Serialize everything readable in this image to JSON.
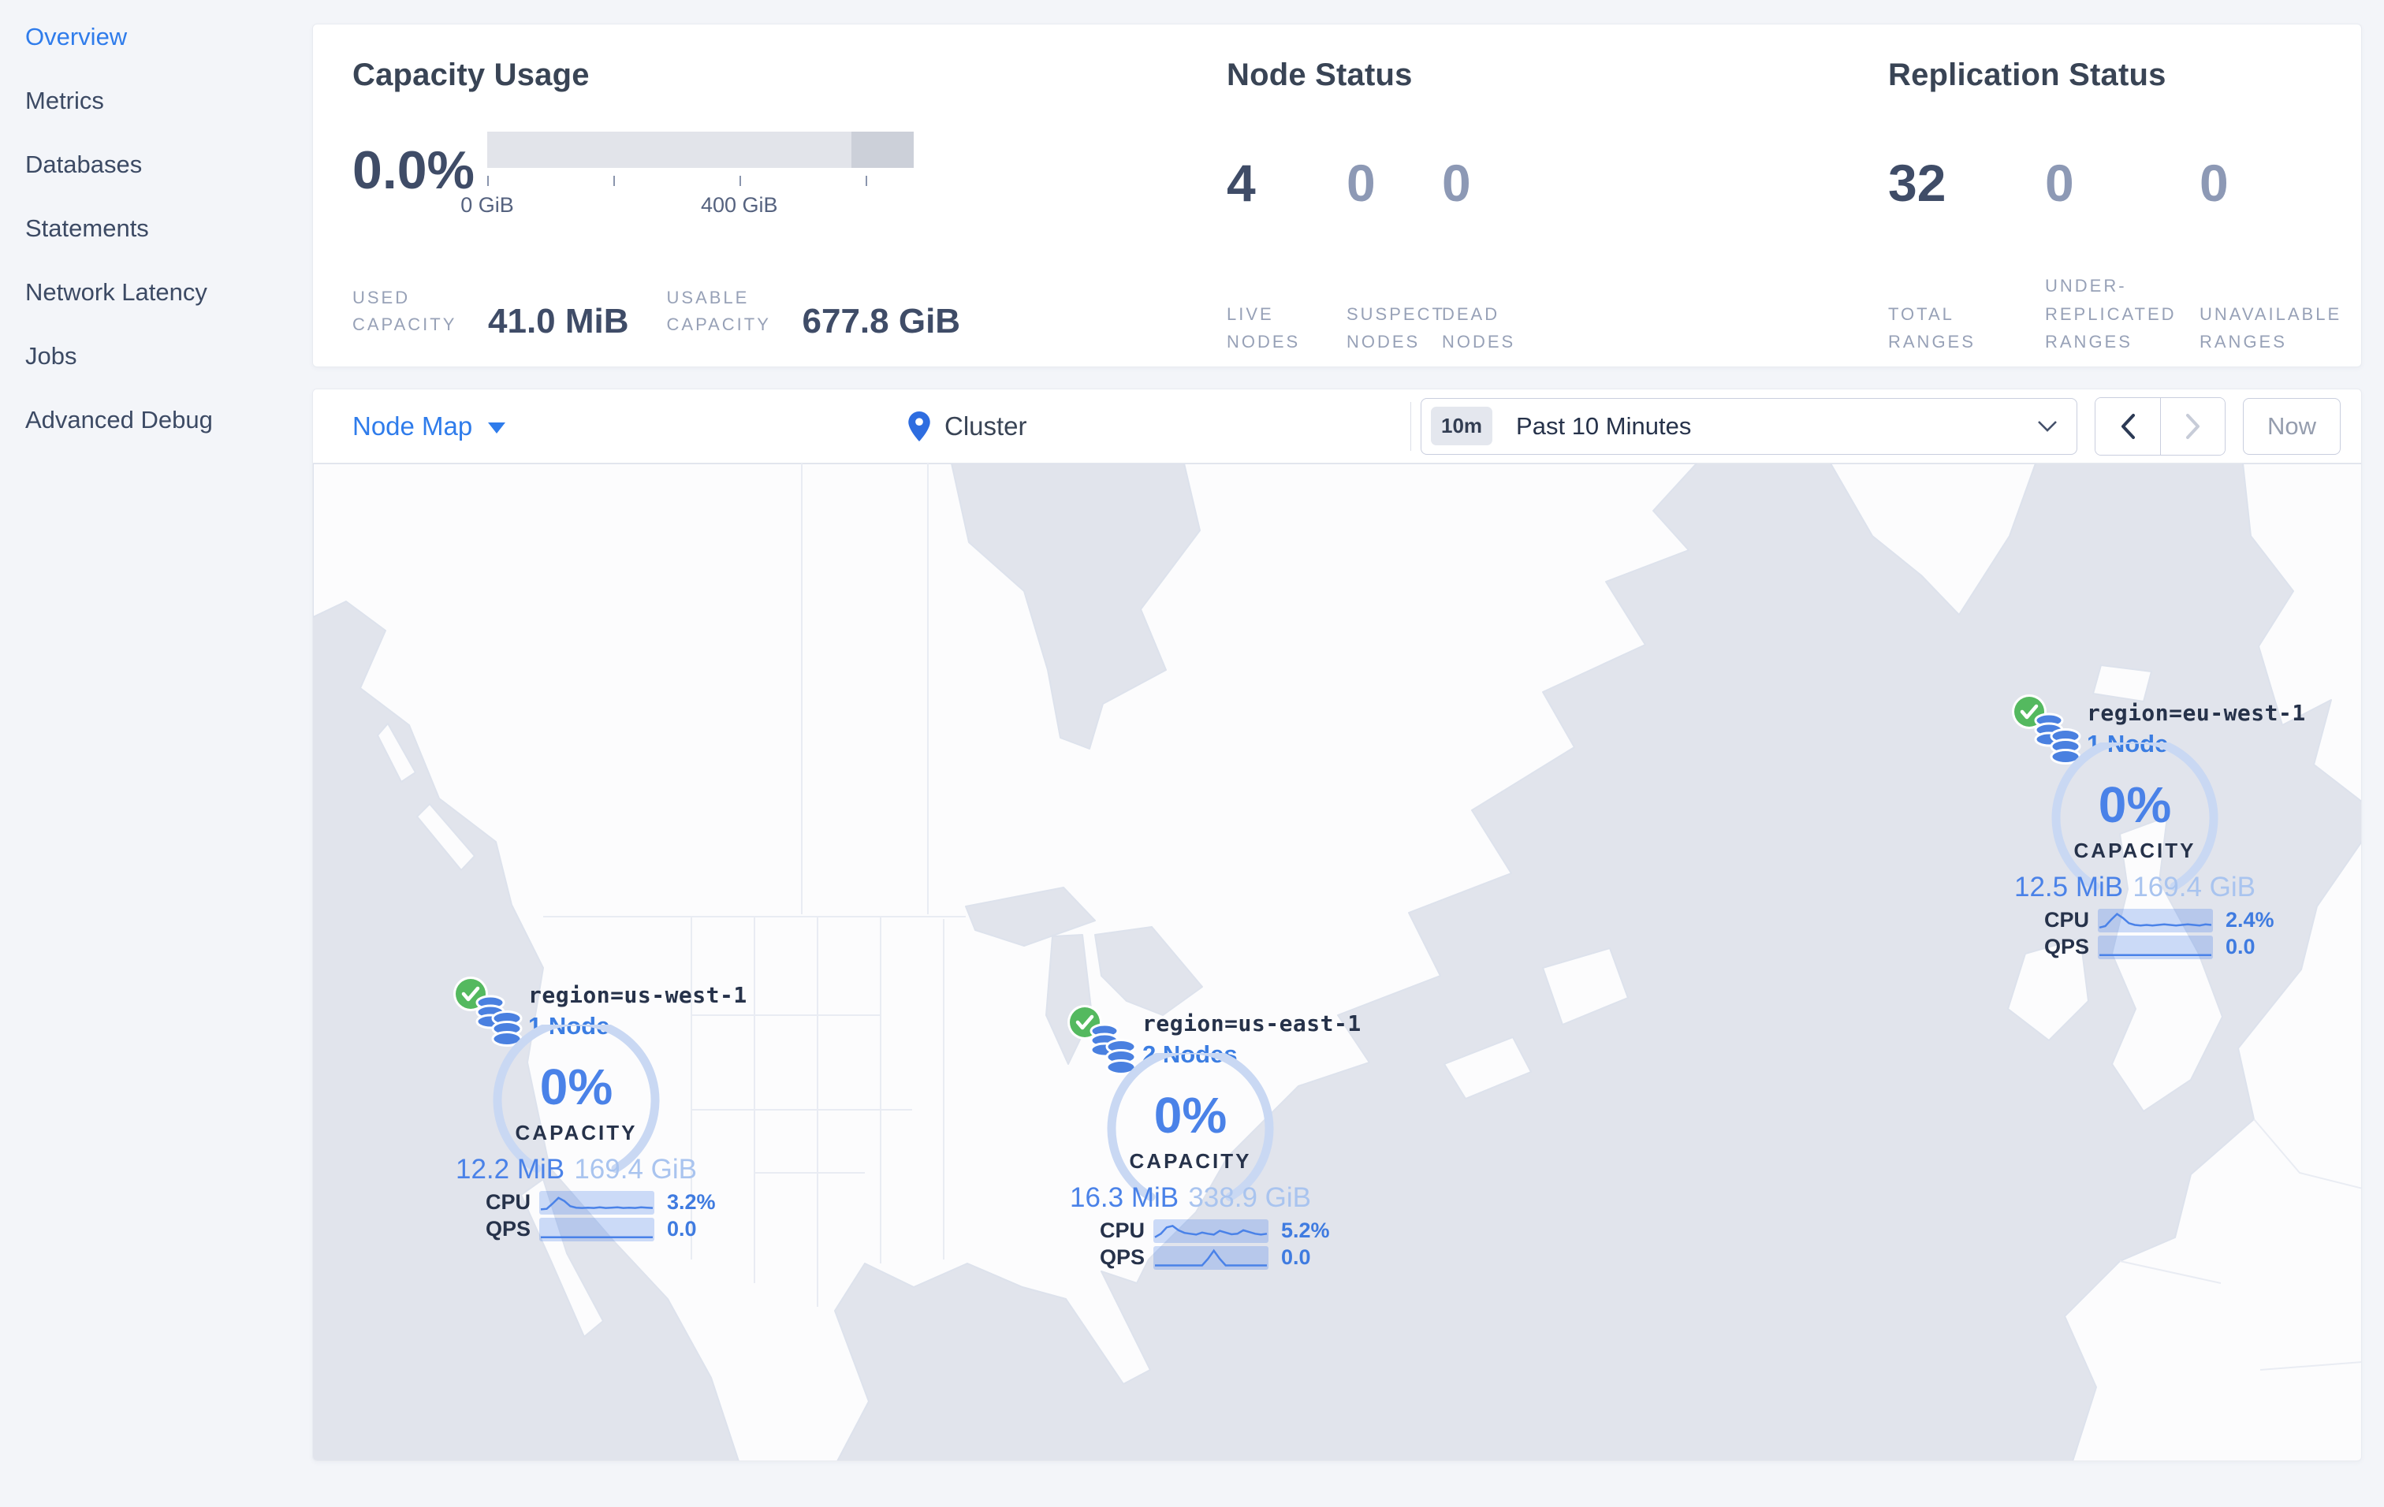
{
  "sidebar": {
    "items": [
      {
        "label": "Overview",
        "active": true
      },
      {
        "label": "Metrics",
        "active": false
      },
      {
        "label": "Databases",
        "active": false
      },
      {
        "label": "Statements",
        "active": false
      },
      {
        "label": "Network Latency",
        "active": false
      },
      {
        "label": "Jobs",
        "active": false
      },
      {
        "label": "Advanced Debug",
        "active": false
      }
    ]
  },
  "summary": {
    "capacity": {
      "title": "Capacity Usage",
      "percent": "0.0%",
      "tick_label_zero": "0 GiB",
      "tick_label_400": "400 GiB",
      "used_label": "USED CAPACITY",
      "used_value": "41.0 MiB",
      "usable_label": "USABLE CAPACITY",
      "usable_value": "677.8 GiB"
    },
    "node_status": {
      "title": "Node Status",
      "stats": [
        {
          "value": "4",
          "label": "LIVE NODES",
          "muted": false
        },
        {
          "value": "0",
          "label": "SUSPECT NODES",
          "muted": true
        },
        {
          "value": "0",
          "label": "DEAD NODES",
          "muted": true
        }
      ]
    },
    "replication": {
      "title": "Replication Status",
      "stats": [
        {
          "value": "32",
          "label": "TOTAL RANGES",
          "muted": false
        },
        {
          "value": "0",
          "label": "UNDER-REPLICATED RANGES",
          "muted": true
        },
        {
          "value": "0",
          "label": "UNAVAILABLE RANGES",
          "muted": true
        }
      ]
    }
  },
  "toolbar": {
    "view_label": "Node Map",
    "breadcrumb": "Cluster",
    "time_badge": "10m",
    "time_range": "Past 10 Minutes",
    "now_label": "Now"
  },
  "markers": [
    {
      "region": "region=us-west-1",
      "nodes": "1 Node",
      "percent": "0%",
      "capacity_label": "CAPACITY",
      "used": "12.2 MiB",
      "total": "169.4 GiB",
      "cpu_label": "CPU",
      "cpu_value": "3.2%",
      "qps_label": "QPS",
      "qps_value": "0.0",
      "cpu_spark": [
        0.12,
        0.15,
        0.45,
        0.78,
        0.6,
        0.3,
        0.22,
        0.2,
        0.22,
        0.2,
        0.24,
        0.2,
        0.22,
        0.24,
        0.2,
        0.22,
        0.2,
        0.24,
        0.22,
        0.2
      ],
      "qps_spark": [
        0.06,
        0.06,
        0.06,
        0.06,
        0.06,
        0.06,
        0.06,
        0.06,
        0.06,
        0.06,
        0.06,
        0.06,
        0.06,
        0.06,
        0.06,
        0.06,
        0.06,
        0.06,
        0.06,
        0.06
      ]
    },
    {
      "region": "region=us-east-1",
      "nodes": "2 Nodes",
      "percent": "0%",
      "capacity_label": "CAPACITY",
      "used": "16.3 MiB",
      "total": "338.9 GiB",
      "cpu_label": "CPU",
      "cpu_value": "5.2%",
      "qps_label": "QPS",
      "qps_value": "0.0",
      "cpu_spark": [
        0.15,
        0.35,
        0.72,
        0.8,
        0.55,
        0.4,
        0.35,
        0.3,
        0.42,
        0.35,
        0.3,
        0.52,
        0.42,
        0.32,
        0.35,
        0.55,
        0.45,
        0.35,
        0.3,
        0.35
      ],
      "qps_spark": [
        0.07,
        0.07,
        0.07,
        0.07,
        0.07,
        0.07,
        0.07,
        0.07,
        0.07,
        0.45,
        0.92,
        0.45,
        0.07,
        0.07,
        0.07,
        0.07,
        0.07,
        0.07,
        0.07,
        0.07
      ]
    },
    {
      "region": "region=eu-west-1",
      "nodes": "1 Node",
      "percent": "0%",
      "capacity_label": "CAPACITY",
      "used": "12.5 MiB",
      "total": "169.4 GiB",
      "cpu_label": "CPU",
      "cpu_value": "2.4%",
      "qps_label": "QPS",
      "qps_value": "0.0",
      "cpu_spark": [
        0.1,
        0.18,
        0.55,
        0.88,
        0.65,
        0.35,
        0.25,
        0.22,
        0.25,
        0.22,
        0.25,
        0.28,
        0.25,
        0.22,
        0.25,
        0.28,
        0.25,
        0.22,
        0.28,
        0.25
      ],
      "qps_spark": [
        0.06,
        0.06,
        0.06,
        0.06,
        0.06,
        0.06,
        0.06,
        0.06,
        0.06,
        0.06,
        0.06,
        0.06,
        0.06,
        0.06,
        0.06,
        0.06,
        0.06,
        0.06,
        0.06,
        0.06
      ]
    }
  ],
  "colors": {
    "accent_blue": "#2f7ceb",
    "gauge_blue": "#4a82e8",
    "gauge_arc": "#c9d8f3",
    "healthy_green": "#54b95f",
    "ocean": "#e1e4ec",
    "land": "#fcfcfd",
    "dark_text": "#394455",
    "muted_text": "#97a1b7"
  }
}
